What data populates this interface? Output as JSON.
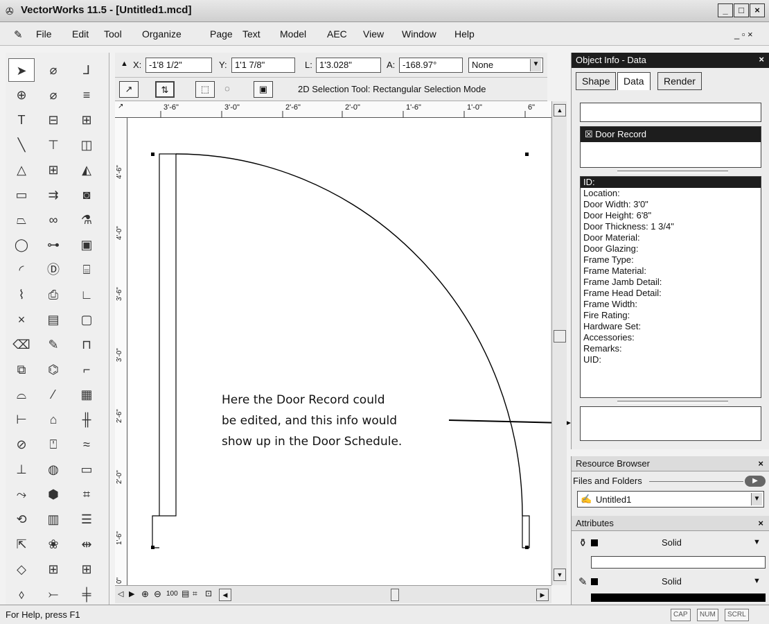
{
  "window": {
    "title": "VectorWorks 11.5 - [Untitled1.mcd]",
    "minimize": "_",
    "restore": "□",
    "close": "×"
  },
  "menu": [
    "File",
    "Edit",
    "Tool",
    "Organize",
    "Page",
    "Text",
    "Model",
    "AEC",
    "View",
    "Window",
    "Help"
  ],
  "coords": {
    "x_label": "X:",
    "x_value": "-1'8 1/2\"",
    "y_label": "Y:",
    "y_value": "1'1 7/8\"",
    "l_label": "L:",
    "l_value": "1'3.028\"",
    "a_label": "A:",
    "a_value": "-168.97°",
    "constraint_value": "None"
  },
  "modebar": {
    "mode_text": "2D Selection Tool: Rectangular Selection Mode"
  },
  "ruler": {
    "h_ticks": [
      "3'-6\"",
      "3'-0\"",
      "2'-6\"",
      "2'-0\"",
      "1'-6\"",
      "1'-0\"",
      "6\""
    ],
    "v_ticks": [
      "4'-6\"",
      "4'-0\"",
      "3'-6\"",
      "3'-0\"",
      "2'-6\"",
      "2'-0\"",
      "1'-6\"",
      "0\""
    ]
  },
  "annotation": {
    "line1": "Here the Door Record could",
    "line2": "be edited, and this info would",
    "line3": "show up in the Door Schedule."
  },
  "object_info": {
    "title": "Object Info - Data",
    "close": "×",
    "tabs": [
      "Shape",
      "Data",
      "Render"
    ],
    "active_tab": "Data",
    "record_name": "Door Record",
    "fields": [
      "ID:",
      "Location:",
      "Door Width: 3'0\"",
      "Door Height: 6'8\"",
      "Door Thickness: 1 3/4\"",
      "Door Material:",
      "Door Glazing:",
      "Frame Type:",
      "Frame Material:",
      "Frame Jamb Detail:",
      "Frame Head Detail:",
      "Frame Width:",
      "Fire Rating:",
      "Hardware Set:",
      "Accessories:",
      "Remarks:",
      "UID:"
    ]
  },
  "resource_browser": {
    "title": "Resource Browser",
    "close": "×",
    "files_label": "Files and Folders",
    "file_value": "Untitled1"
  },
  "attributes": {
    "title": "Attributes",
    "close": "×",
    "fill_value": "Solid",
    "pen_value": "Solid"
  },
  "status": {
    "help_text": "For Help, press F1",
    "indicators": [
      "CAP",
      "NUM",
      "SCRL"
    ]
  },
  "zoom_label": "100"
}
